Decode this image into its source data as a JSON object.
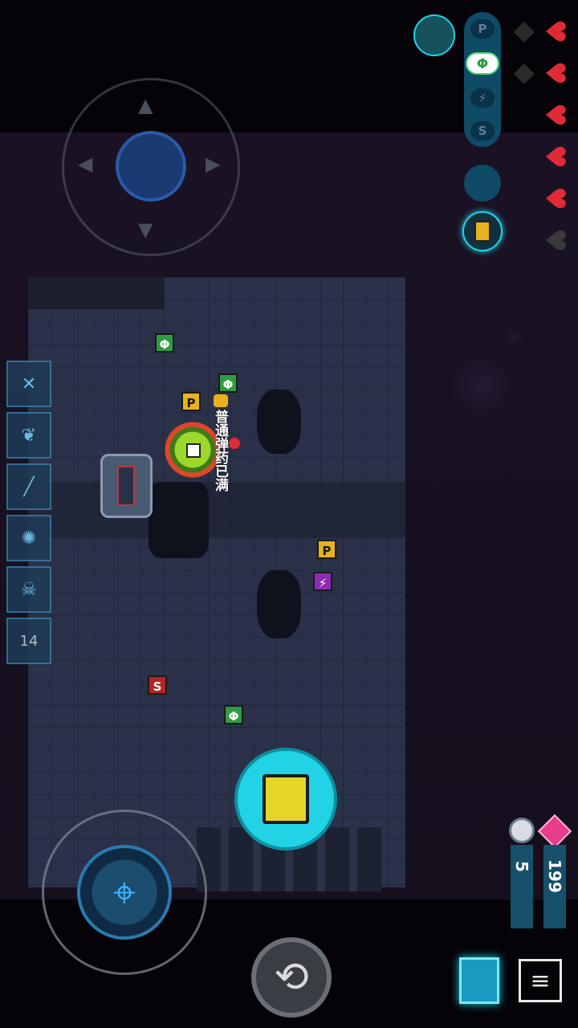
{
  "hud": {
    "hearts": {
      "filled": 5,
      "total": 6
    },
    "shields": {
      "total": 2
    },
    "ammo_slots": [
      {
        "label": "P",
        "color": "#5a7fa0",
        "active": false
      },
      {
        "label": "Φ",
        "color": "#3fd96a",
        "active": true
      },
      {
        "label": "⚡",
        "color": "#5a7fa0",
        "active": false
      },
      {
        "label": "S",
        "color": "#5a7fa0",
        "active": false
      }
    ],
    "skills": [
      {
        "icon": "crossed-swords-icon",
        "glyph": "✕"
      },
      {
        "icon": "wings-icon",
        "glyph": "❦"
      },
      {
        "icon": "gun-icon",
        "glyph": "╱"
      },
      {
        "icon": "target-icon",
        "glyph": "✺"
      },
      {
        "icon": "skull-icon",
        "glyph": "☠"
      },
      {
        "icon": "card-icon",
        "glyph": "14"
      }
    ],
    "currency": {
      "cores": "5",
      "gems": "199"
    },
    "fire_button_icon": "weapon-swap-icon",
    "reload_icon": "reload-icon",
    "minimap_icon": "minimap-icon",
    "menu_icon": "menu-icon"
  },
  "world": {
    "notification": "普通弹药已满",
    "pickups": [
      {
        "type": "Φ",
        "color": "green"
      },
      {
        "type": "Φ",
        "color": "green"
      },
      {
        "type": "P",
        "color": "yellow"
      },
      {
        "type": "P",
        "color": "yellow"
      },
      {
        "type": "⚡",
        "color": "purple"
      },
      {
        "type": "S",
        "color": "red"
      },
      {
        "type": "Φ",
        "color": "green"
      }
    ]
  },
  "colors": {
    "accent": "#22d3e6",
    "heart": "#e02a35",
    "gem": "#e83c8c"
  }
}
